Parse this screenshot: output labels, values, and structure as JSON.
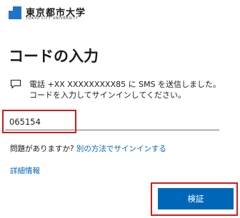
{
  "logo": {
    "name": "東京都市大学",
    "subtitle": "TOKYO CITY UNIVERSITY",
    "icon": "university-logo",
    "color": "#1e74c8"
  },
  "page_title": "コードの入力",
  "message": {
    "icon": "speech-bubble-icon",
    "line1": "電話 +XX XXXXXXXXX85 に SMS を送信しました。",
    "line2": "コードを入力してサインインしてください。"
  },
  "code_input": {
    "value": "065154"
  },
  "help": {
    "question": "問題がありますか?",
    "link": "別の方法でサインインする"
  },
  "details_link": "詳細情報",
  "verify_button": "検証",
  "colors": {
    "accent": "#0067b8",
    "highlight": "#d11a1a",
    "text": "#1b1b1b"
  }
}
